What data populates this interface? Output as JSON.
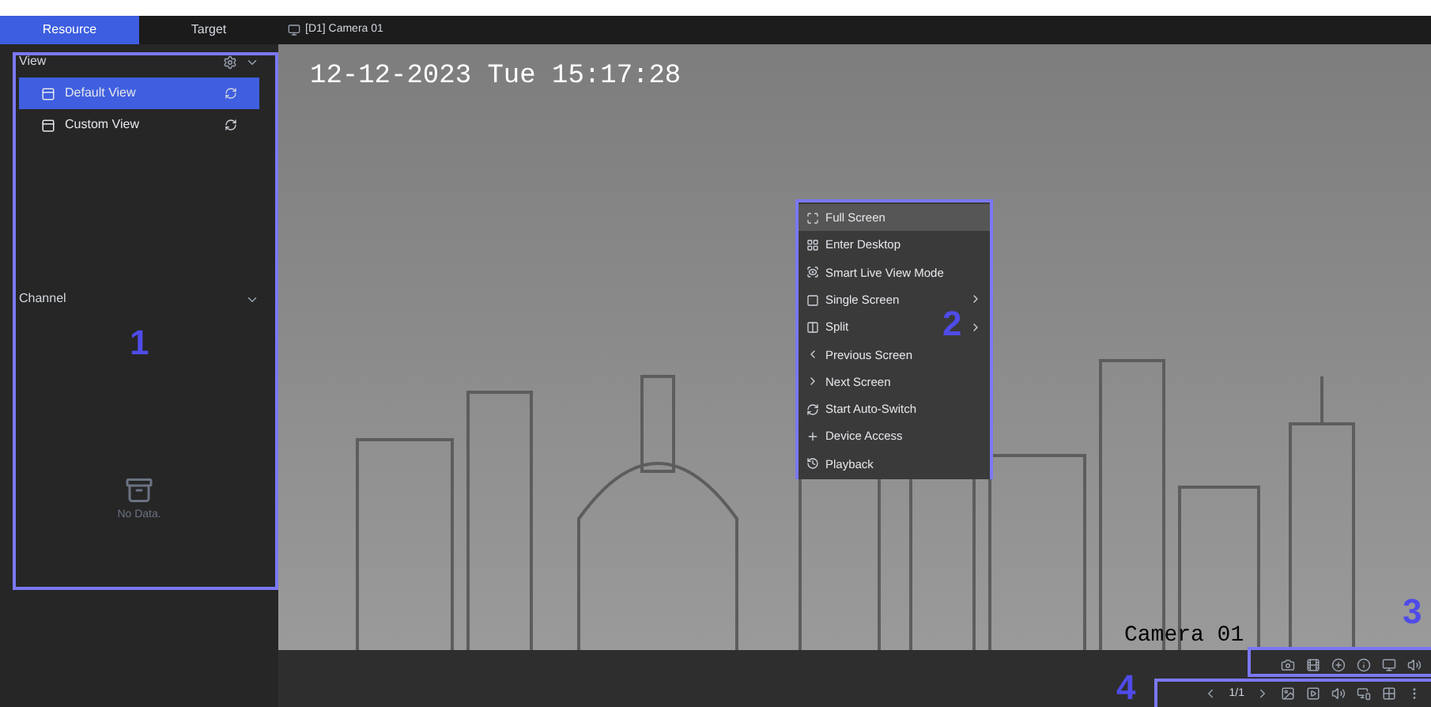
{
  "tabs": [
    {
      "label": "Resource",
      "selected": true
    },
    {
      "label": "Target",
      "selected": false
    }
  ],
  "view_section": {
    "title": "View",
    "items": [
      {
        "label": "Default View",
        "selected": true
      },
      {
        "label": "Custom View",
        "selected": false
      }
    ]
  },
  "channel_section": {
    "title": "Channel",
    "empty_text": "No Data."
  },
  "video": {
    "title": "[D1] Camera 01",
    "timestamp": "12-12-2023 Tue 15:17:28",
    "camera_label": "Camera 01"
  },
  "context_menu": [
    {
      "label": "Full Screen",
      "selected": true,
      "has_submenu": false
    },
    {
      "label": "Enter Desktop",
      "selected": false,
      "has_submenu": false
    },
    {
      "label": "Smart Live View Mode",
      "selected": false,
      "has_submenu": false
    },
    {
      "label": "Single Screen",
      "selected": false,
      "has_submenu": true
    },
    {
      "label": "Split",
      "selected": false,
      "has_submenu": true
    },
    {
      "label": "Previous Screen",
      "selected": false,
      "has_submenu": false
    },
    {
      "label": "Next Screen",
      "selected": false,
      "has_submenu": false
    },
    {
      "label": "Start Auto-Switch",
      "selected": false,
      "has_submenu": false
    },
    {
      "label": "Device Access",
      "selected": false,
      "has_submenu": false
    },
    {
      "label": "Playback",
      "selected": false,
      "has_submenu": false
    }
  ],
  "pager": {
    "page": "1/1"
  },
  "annotations": [
    {
      "number": "1"
    },
    {
      "number": "2"
    },
    {
      "number": "3"
    },
    {
      "number": "4"
    }
  ]
}
